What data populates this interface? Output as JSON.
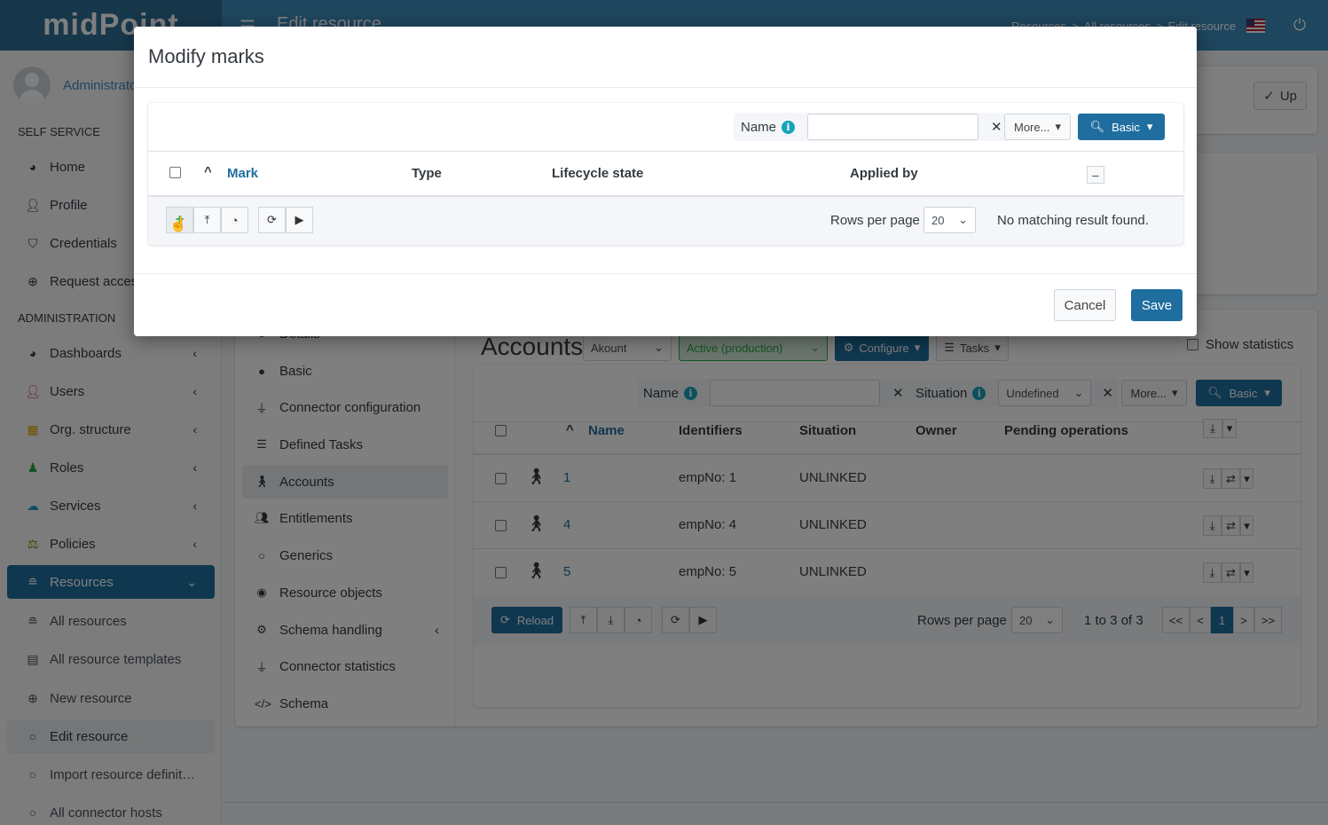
{
  "topbar": {
    "brand": "midPoint",
    "title": "Edit resource",
    "breadcrumbs": [
      "Resources",
      ">",
      "All resources",
      ">",
      "Edit resource"
    ],
    "hamburger_icon": "☰",
    "power_icon": "⏻"
  },
  "sidebar": {
    "user_name": "Administrator",
    "sections": [
      {
        "header": "SELF SERVICE"
      },
      {
        "header": "ADMINISTRATION"
      }
    ],
    "self_service": [
      {
        "label": "Home",
        "icon": "dashboard-icon"
      },
      {
        "label": "Profile",
        "icon": "user-icon"
      },
      {
        "label": "Credentials",
        "icon": "shield-icon"
      },
      {
        "label": "Request access",
        "icon": "plus-circle-icon"
      }
    ],
    "administration": [
      {
        "label": "Dashboards",
        "icon": "dashboard-icon",
        "expandable": true
      },
      {
        "label": "Users",
        "icon": "user-icon",
        "expandable": true
      },
      {
        "label": "Org. structure",
        "icon": "building-icon",
        "expandable": true
      },
      {
        "label": "Roles",
        "icon": "roles-icon",
        "expandable": true
      },
      {
        "label": "Services",
        "icon": "cloud-icon",
        "expandable": true
      },
      {
        "label": "Policies",
        "icon": "scale-icon",
        "expandable": true
      },
      {
        "label": "Resources",
        "icon": "database-icon",
        "expanded": true,
        "active": true
      }
    ],
    "resources_sub": [
      {
        "label": "All resources",
        "icon": "database-icon"
      },
      {
        "label": "All resource templates",
        "icon": "file-icon"
      },
      {
        "label": "New resource",
        "icon": "plus-circle-icon"
      },
      {
        "label": "Edit resource",
        "icon": "circle-icon",
        "current": true
      },
      {
        "label": "Import resource definit…",
        "icon": "circle-icon"
      },
      {
        "label": "All connector hosts",
        "icon": "circle-icon"
      }
    ]
  },
  "header_card": {
    "up_button": "Up"
  },
  "resource_nav": [
    {
      "label": "Details",
      "icon": "info-icon"
    },
    {
      "label": "Basic",
      "icon": "circle-filled-icon"
    },
    {
      "label": "Connector configuration",
      "icon": "plug-icon"
    },
    {
      "label": "Defined Tasks",
      "icon": "tasks-icon"
    },
    {
      "label": "Accounts",
      "icon": "person-icon",
      "current": true
    },
    {
      "label": "Entitlements",
      "icon": "users-icon"
    },
    {
      "label": "Generics",
      "icon": "circle-icon"
    },
    {
      "label": "Resource objects",
      "icon": "eye-icon"
    },
    {
      "label": "Schema handling",
      "icon": "cogs-icon",
      "expandable": true
    },
    {
      "label": "Connector statistics",
      "icon": "plug-icon"
    },
    {
      "label": "Schema",
      "icon": "code-icon"
    }
  ],
  "accounts": {
    "title": "Accounts",
    "kind_select": "Akount",
    "lifecycle_select": "Active (production)",
    "configure_button": "Configure",
    "tasks_button": "Tasks",
    "show_statistics": "Show statistics",
    "search": {
      "name_label": "Name",
      "name_value": "",
      "situation_label": "Situation",
      "situation_value": "Undefined",
      "more_button": "More...",
      "basic_button": "Basic"
    },
    "columns": [
      "Name",
      "Identifiers",
      "Situation",
      "Owner",
      "Pending operations"
    ],
    "rows": [
      {
        "name": "1",
        "identifiers": "empNo: 1",
        "situation": "UNLINKED",
        "owner": "",
        "pending": ""
      },
      {
        "name": "4",
        "identifiers": "empNo: 4",
        "situation": "UNLINKED",
        "owner": "",
        "pending": ""
      },
      {
        "name": "5",
        "identifiers": "empNo: 5",
        "situation": "UNLINKED",
        "owner": "",
        "pending": ""
      }
    ],
    "footer": {
      "reload_button": "Reload",
      "rows_per_page_label": "Rows per page",
      "rows_per_page_value": "20",
      "range_text": "1 to 3 of 3",
      "pagination": [
        "<<",
        "<",
        "1",
        ">",
        ">>"
      ],
      "current_page": "1"
    }
  },
  "modal": {
    "title": "Modify marks",
    "search": {
      "name_label": "Name",
      "name_value": "",
      "more_button": "More...",
      "basic_button": "Basic"
    },
    "columns": [
      "Mark",
      "Type",
      "Lifecycle state",
      "Applied by"
    ],
    "rows_per_page_label": "Rows per page",
    "rows_per_page_value": "20",
    "empty_text": "No matching result found.",
    "cancel_button": "Cancel",
    "save_button": "Save"
  }
}
